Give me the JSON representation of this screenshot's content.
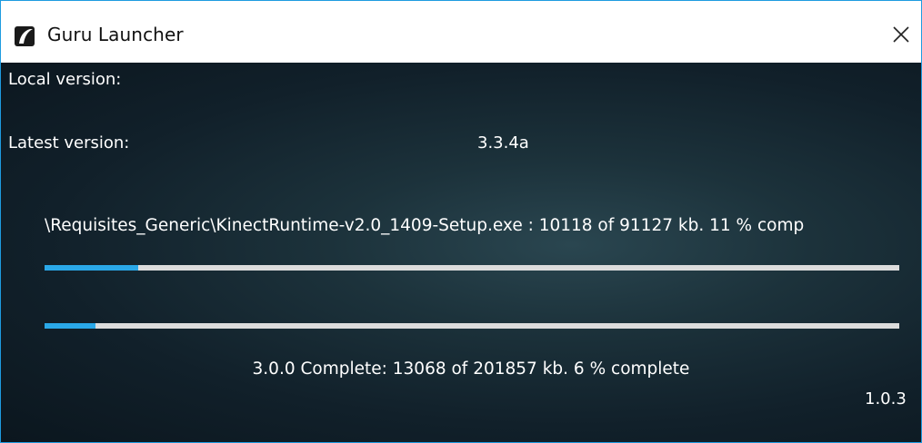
{
  "window": {
    "title": "Guru Launcher",
    "icon": "guru-logo-icon",
    "close_icon": "close-icon",
    "accent_color": "#1e9be0"
  },
  "versions": {
    "local_label": "Local version:",
    "local_value": "",
    "latest_label": "Latest version:",
    "latest_value": "3.3.4a"
  },
  "download": {
    "file_status": "\\Requisites_Generic\\KinectRuntime-v2.0_1409-Setup.exe : 10118 of 91127 kb.  11 % comp",
    "file_progress": 0.11,
    "overall_progress": 0.06,
    "overall_status": "3.0.0 Complete: 13068 of 201857 kb.  6 % complete",
    "progress_color": "#2aa8e8",
    "track_color": "#dcdcdc"
  },
  "footer": {
    "launcher_version": "1.0.3"
  }
}
